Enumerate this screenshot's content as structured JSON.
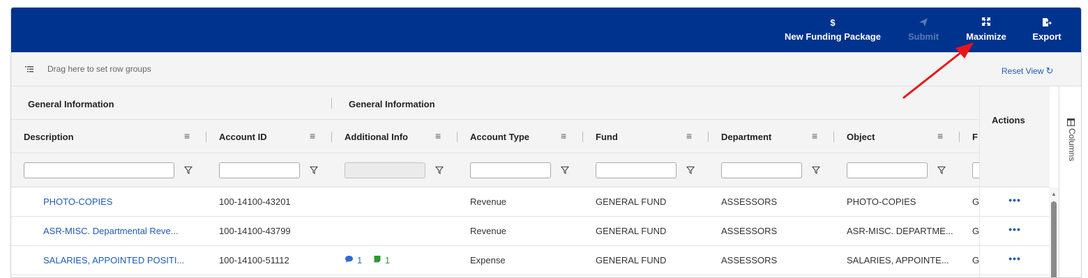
{
  "toolbar": {
    "funding_icon": "$",
    "funding_label": "New Funding Package",
    "submit_label": "Submit",
    "maximize_label": "Maximize",
    "export_label": "Export",
    "background_color": "#00338d",
    "disabled_color": "#5b7bb6"
  },
  "groupbar": {
    "hint": "Drag here to set row groups",
    "reset_label": "Reset View",
    "reset_icon": "↻"
  },
  "grid": {
    "group_headers": [
      "General Information",
      "General Information"
    ],
    "columns": [
      "Description",
      "Account ID",
      "Additional Info",
      "Account Type",
      "Fund",
      "Department",
      "Object",
      "F"
    ],
    "menu_icon": "≡",
    "actions_header": "Actions",
    "side_panel_label": "Columns",
    "rows": [
      {
        "description": "PHOTO-COPIES",
        "account_id": "100-14100-43201",
        "comments": "",
        "notes": "",
        "account_type": "Revenue",
        "fund": "GENERAL FUND",
        "department": "ASSESSORS",
        "object": "PHOTO-COPIES",
        "next": "G",
        "actions": "•••"
      },
      {
        "description": "ASR-MISC. Departmental Reve...",
        "account_id": "100-14100-43799",
        "comments": "",
        "notes": "",
        "account_type": "Revenue",
        "fund": "GENERAL FUND",
        "department": "ASSESSORS",
        "object": "ASR-MISC. DEPARTME...",
        "next": "G",
        "actions": "•••"
      },
      {
        "description": "SALARIES, APPOINTED POSITI...",
        "account_id": "100-14100-51112",
        "comments": "1",
        "notes": "1",
        "account_type": "Expense",
        "fund": "GENERAL FUND",
        "department": "ASSESSORS",
        "object": "SALARIES, APPOINTE...",
        "next": "G",
        "actions": "•••"
      }
    ]
  },
  "colors": {
    "link": "#1f5ab5",
    "comment_badge": "#2c6ad6",
    "note_badge": "#2e9a2e",
    "annotation_arrow": "#e8141a"
  }
}
